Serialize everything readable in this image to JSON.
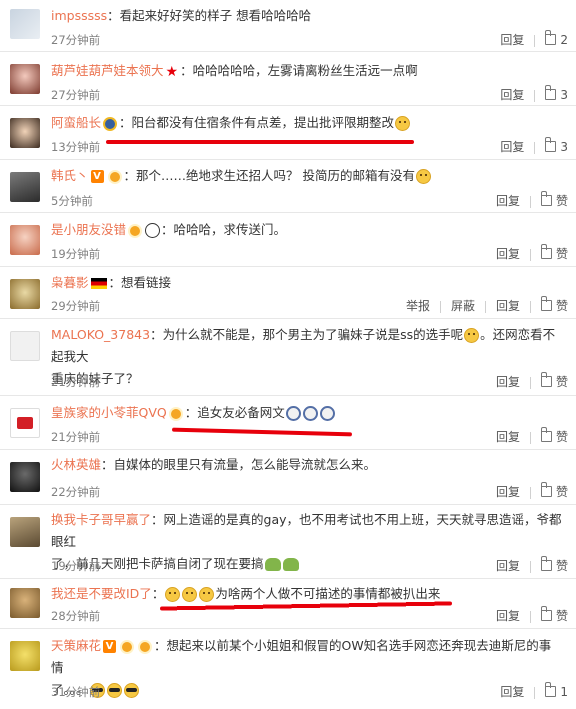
{
  "labels": {
    "reply": "回复",
    "report": "举报",
    "block": "屏蔽"
  },
  "comments": [
    {
      "user": "impsssss",
      "sep": "：",
      "text": "看起来好好笑的样子 想看哈哈哈哈",
      "time": "27分钟前",
      "likes": "2"
    },
    {
      "user": "葫芦娃葫芦娃本领大",
      "sep": "：",
      "text": "哈哈哈哈哈，左雾请离粉丝生活远一点啊",
      "time": "27分钟前",
      "likes": "3"
    },
    {
      "user": "阿蛮船长",
      "sep": "：",
      "text": "阳台都没有住宿条件有点差，提出批评限期整改",
      "time": "13分钟前",
      "likes": "3"
    },
    {
      "user": "韩氏丶",
      "sep": "：",
      "text": "那个……绝地求生还招人吗？ 投简历的邮箱有没有",
      "time": "5分钟前",
      "likes": "赞"
    },
    {
      "user": "是小朋友没错",
      "sep": "：",
      "text": "哈哈哈，求传送门。",
      "time": "19分钟前",
      "likes": "赞"
    },
    {
      "user": "枭暮影",
      "sep": "：",
      "text": "想看链接",
      "time": "29分钟前",
      "likes": "赞"
    },
    {
      "user": "MALOKO_37843",
      "sep": "：",
      "text": "为什么就不能是，那个男主为了骗妹子说是ss的选手呢",
      "text2": "。还网恋看不起我大",
      "line2": "重庆的妹子了？",
      "time": "21分钟前",
      "likes": "赞"
    },
    {
      "user": "皇族家的小苓菲QVQ",
      "sep": "：",
      "text": "追女友必备网文",
      "time": "21分钟前",
      "likes": "赞"
    },
    {
      "user": "火林英雄",
      "sep": "：",
      "text": "自媒体的眼里只有流量，怎么能导流就怎么来。",
      "time": "22分钟前",
      "likes": "赞"
    },
    {
      "user": "换我卡子哥早赢了",
      "sep": "：",
      "text": "网上造谣的是真的gay，也不用考试也不用上班，天天就寻思造谣，爷都眼红",
      "line2": "了，前几天刚把卡萨搞自闭了现在要搞",
      "time": "19分钟前",
      "likes": "赞"
    },
    {
      "user": "我还是不要改ID了",
      "sep": "：",
      "text": "为啥两个人做不可描述的事情都被扒出来",
      "time": "28分钟前",
      "likes": "赞"
    },
    {
      "user": "天策麻花",
      "sep": "：",
      "text": "想起来以前某个小姐姐和假冒的OW知名选手网恋还奔现去迪斯尼的事情",
      "line2": "了。。。",
      "time": "31分钟前",
      "likes": "1"
    }
  ]
}
